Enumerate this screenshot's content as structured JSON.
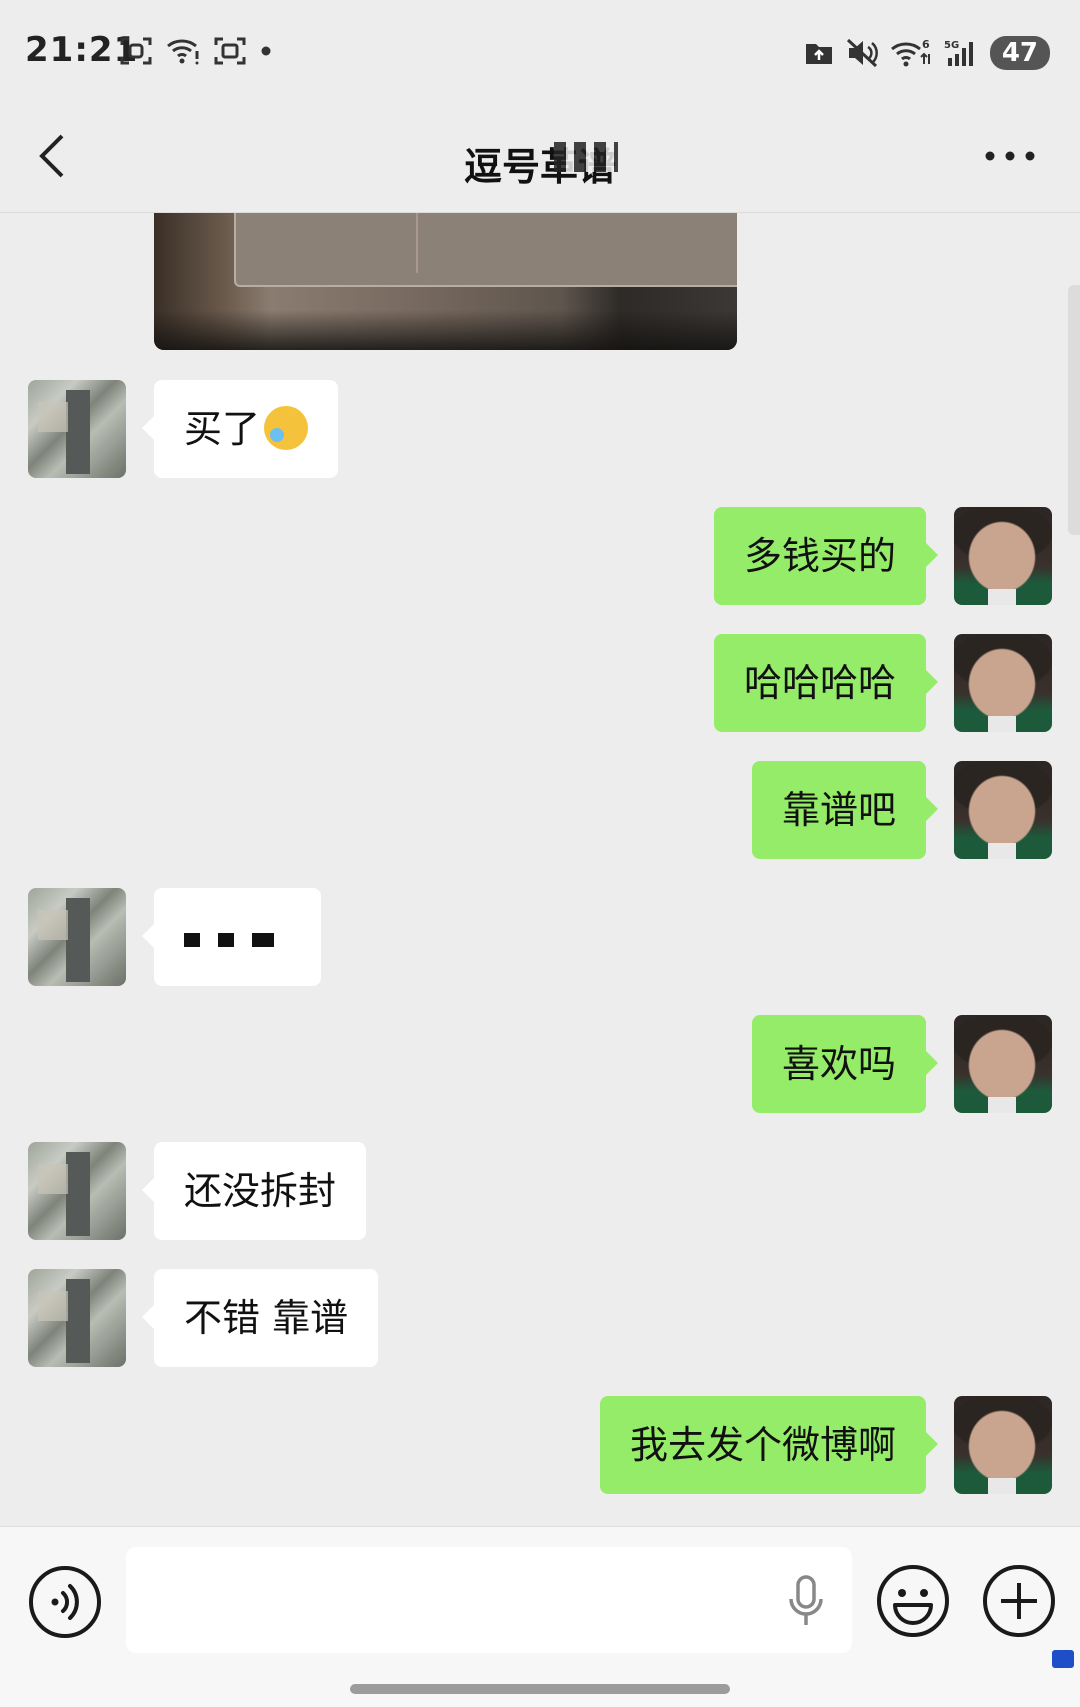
{
  "status_bar": {
    "time": "21:21",
    "battery": "47",
    "icons_left": [
      "scan-icon",
      "wifi-warning-icon",
      "photo-scan-icon",
      "dot-icon"
    ],
    "icons_right": [
      "folder-upload-icon",
      "mute-icon",
      "wifi-6-icon",
      "signal-5g-icon",
      "battery-icon"
    ]
  },
  "header": {
    "title": "逗号革谱",
    "back_icon": "chevron-left-icon",
    "more_icon": "more-dots-icon"
  },
  "messages": [
    {
      "side": "left",
      "type": "image",
      "description_icon": "photo-laptop"
    },
    {
      "side": "left",
      "text": "买了",
      "emoji": "crying-laughing-emoji"
    },
    {
      "side": "right",
      "text": "多钱买的"
    },
    {
      "side": "right",
      "text": "哈哈哈哈"
    },
    {
      "side": "right",
      "text": "靠谱吧"
    },
    {
      "side": "left",
      "text": "",
      "redacted": true
    },
    {
      "side": "right",
      "text": "喜欢吗"
    },
    {
      "side": "left",
      "text": "还没拆封"
    },
    {
      "side": "left",
      "text": "不错 靠谱"
    },
    {
      "side": "right",
      "text": "我去发个微博啊"
    }
  ],
  "input_bar": {
    "placeholder": "",
    "voice_icon": "voice-icon",
    "mic_icon": "microphone-icon",
    "emoji_icon": "smiley-icon",
    "plus_icon": "plus-icon"
  },
  "colors": {
    "background": "#ededed",
    "bubble_self": "#95ec69",
    "bubble_other": "#ffffff"
  }
}
